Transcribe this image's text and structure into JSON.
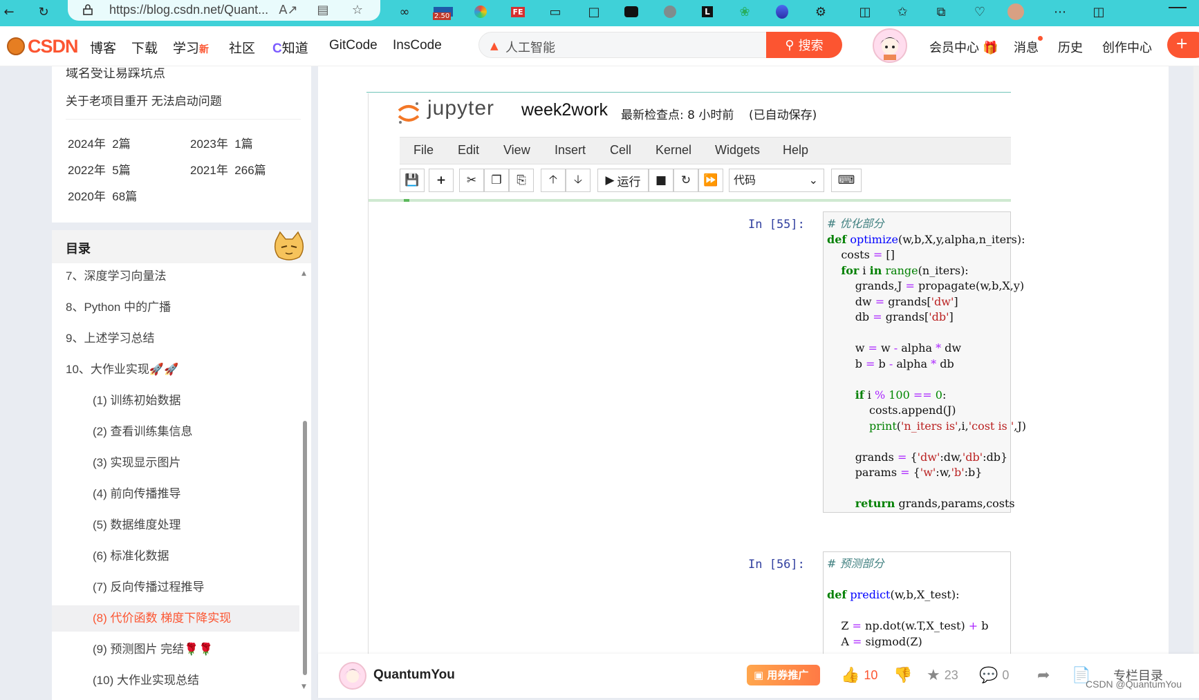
{
  "browser": {
    "url": "https://blog.csdn.net/Quant...",
    "badge": "2.50",
    "icon_names": [
      "back-icon",
      "refresh-icon",
      "lock-icon",
      "read-aloud-icon",
      "immersive-reader-icon",
      "favorite-star-icon",
      "infinity-icon",
      "ext-badge-icon",
      "ext-ball-icon",
      "ext-fe-icon",
      "ext-window-icon",
      "bookmark-icon",
      "ext-dots-icon",
      "ext-globe-icon",
      "ext-l-icon",
      "ext-tree-icon",
      "ext-drop-icon",
      "extensions-icon",
      "split-screen-icon",
      "favorites-icon",
      "collections-icon",
      "health-icon",
      "profile-icon",
      "more-icon",
      "sidebar-icon"
    ]
  },
  "csdn": {
    "logo": "CSDN",
    "nav": [
      "博客",
      "下载",
      "学习",
      "社区",
      "知道",
      "GitCode",
      "InsCode"
    ],
    "new_tag": "新",
    "search_placeholder": "人工智能",
    "search_button": "搜索",
    "right_nav": [
      "会员中心",
      "消息",
      "历史",
      "创作中心"
    ],
    "create_symbol": "+"
  },
  "sidebar": {
    "partial_title": "域名受让易踩坑点",
    "article_title": "关于老项目重开 无法启动问题",
    "archives": [
      {
        "year": "2024年",
        "count": "2篇"
      },
      {
        "year": "2023年",
        "count": "1篇"
      },
      {
        "year": "2022年",
        "count": "5篇"
      },
      {
        "year": "2021年",
        "count": "266篇"
      },
      {
        "year": "2020年",
        "count": "68篇"
      }
    ],
    "toc_title": "目录",
    "toc": [
      {
        "label": "7、深度学习向量法",
        "level": 1,
        "active": false
      },
      {
        "label": "8、Python 中的广播",
        "level": 1,
        "active": false
      },
      {
        "label": "9、上述学习总结",
        "level": 1,
        "active": false
      },
      {
        "label": "10、大作业实现🚀🚀",
        "level": 1,
        "active": false
      },
      {
        "label": "(1) 训练初始数据",
        "level": 2,
        "active": false
      },
      {
        "label": "(2) 查看训练集信息",
        "level": 2,
        "active": false
      },
      {
        "label": "(3) 实现显示图片",
        "level": 2,
        "active": false
      },
      {
        "label": "(4) 前向传播推导",
        "level": 2,
        "active": false
      },
      {
        "label": "(5) 数据维度处理",
        "level": 2,
        "active": false
      },
      {
        "label": "(6) 标准化数据",
        "level": 2,
        "active": false
      },
      {
        "label": "(7)  反向传播过程推导",
        "level": 2,
        "active": false
      },
      {
        "label": "(8) 代价函数 梯度下降实现",
        "level": 2,
        "active": true
      },
      {
        "label": "(9) 预测图片 完结🌹🌹",
        "level": 2,
        "active": false
      },
      {
        "label": "(10) 大作业实现总结",
        "level": 2,
        "active": false
      }
    ]
  },
  "jupyter": {
    "logo_text": "jupyter",
    "notebook": "week2work",
    "checkpoint": "最新检查点: 8 小时前",
    "autosave": "(已自动保存)",
    "menu": [
      "File",
      "Edit",
      "View",
      "Insert",
      "Cell",
      "Kernel",
      "Widgets",
      "Help"
    ],
    "run_label": "运行",
    "cell_type": "代码",
    "cells": [
      {
        "prompt": "In  [55]:"
      },
      {
        "prompt": "In  [56]:"
      }
    ]
  },
  "bottom": {
    "username": "QuantumYou",
    "promo": "用券推广",
    "likes": "10",
    "favorites": "23",
    "comments": "0",
    "column_menu": "专栏目录",
    "watermark": "CSDN @QuantumYou"
  },
  "colors": {
    "brand": "#fc5531",
    "browser": "#3fd1d8",
    "jupyter_prompt": "#303f9f"
  }
}
